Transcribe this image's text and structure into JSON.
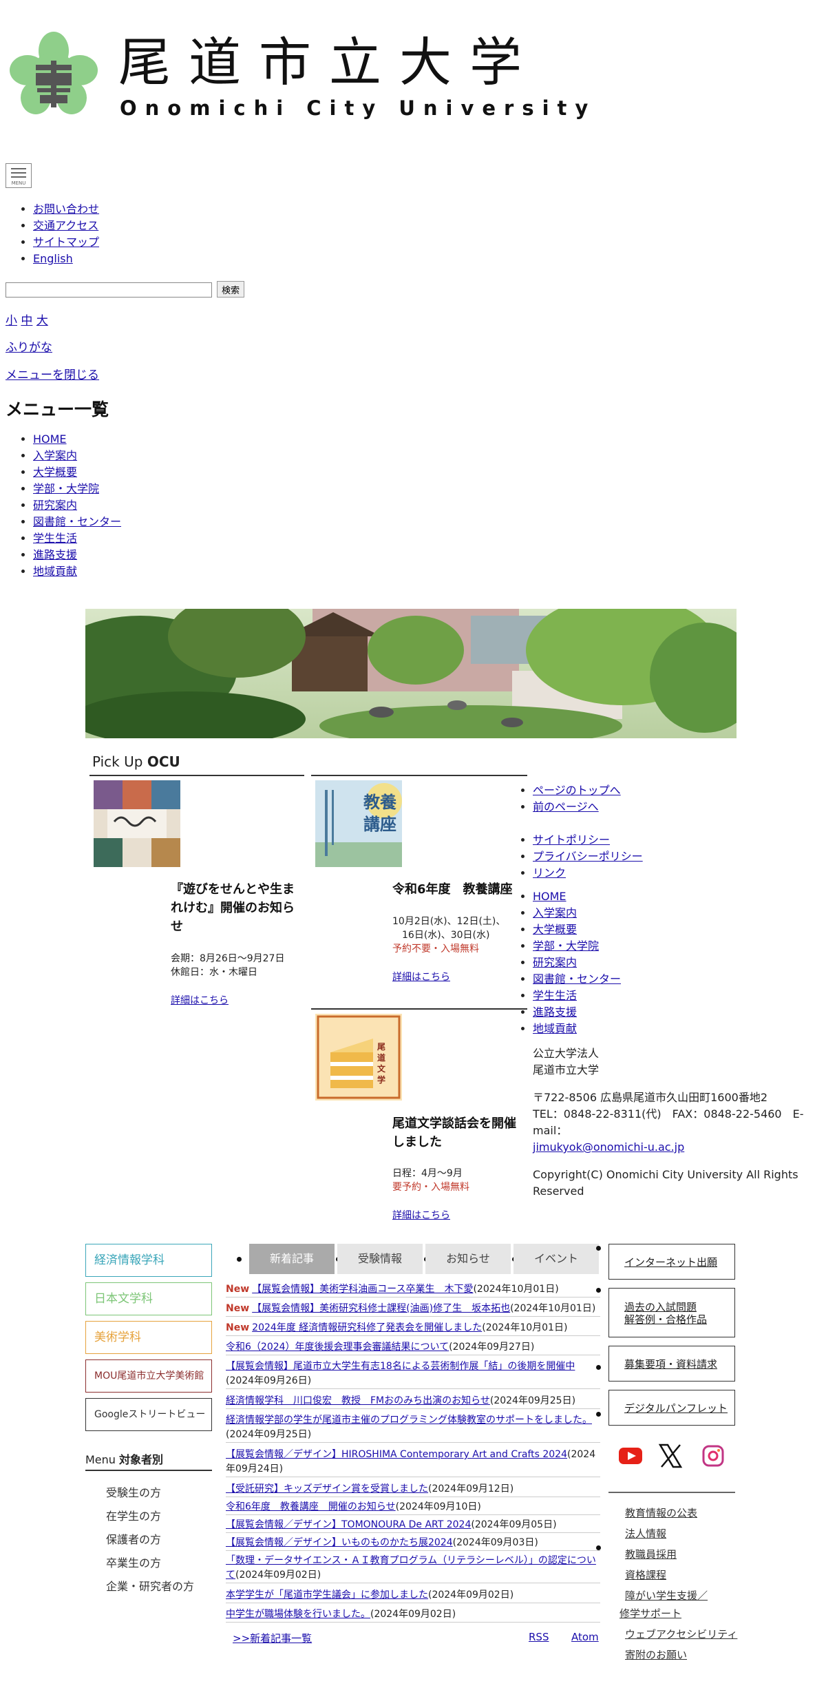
{
  "header": {
    "title_jp": "尾道市立大学",
    "title_en": "Onomichi City University"
  },
  "menu_button": {
    "label": "MENU"
  },
  "top_links": [
    "お問い合わせ",
    "交通アクセス",
    "サイトマップ",
    "English"
  ],
  "search": {
    "placeholder": "",
    "button": "検索"
  },
  "font_size": {
    "small": "小",
    "medium": "中",
    "large": "大"
  },
  "furigana": "ふりがな",
  "close_menu": "メニューを閉じる",
  "menu_heading": "メニュー一覧",
  "menu_items": [
    "HOME",
    "入学案内",
    "大学概要",
    "学部・大学院",
    "研究案内",
    "図書館・センター",
    "学生生活",
    "進路支援",
    "地域貢献"
  ],
  "pickup": {
    "title_prefix": "Pick Up ",
    "title_bold": "OCU",
    "cards": [
      {
        "title": "『遊びをせんとや生まれけむ』開催のお知らせ",
        "line1": "会期：8月26日〜9月27日",
        "line2": "休館日：水・木曜日",
        "red": "",
        "more": "詳細はこちら"
      },
      {
        "title": "令和6年度　教養講座",
        "line1": "10月2日(水)、12日(土)、",
        "line2": "　16日(水)、30日(水)",
        "red": "予約不要・入場無料",
        "more": "詳細はこちら"
      },
      {
        "title": "尾道文学談話会を開催しました",
        "line1": "日程：4月〜9月",
        "line2": "",
        "red": "要予約・入場無料",
        "more": "詳細はこちら"
      }
    ],
    "thumb_texts": {
      "card2": "教養講座",
      "card3": "尾道文学談話会"
    }
  },
  "footer_links1": [
    "ページのトップへ",
    "前のページへ"
  ],
  "footer_links2": [
    "サイトポリシー",
    "プライバシーポリシー",
    "リンク"
  ],
  "footer_menu": [
    "HOME",
    "入学案内",
    "大学概要",
    "学部・大学院",
    "研究案内",
    "図書館・センター",
    "学生生活",
    "進路支援",
    "地域貢献"
  ],
  "footer_info": {
    "org1": "公立大学法人",
    "org2": "尾道市立大学",
    "address": "〒722-8506 広島県尾道市久山田町1600番地2",
    "tel": "TEL：0848-22-8311(代)　FAX：0848-22-5460　E-mail：",
    "email": "jimukyok@onomichi-u.ac.jp",
    "copyright": "Copyright(C) Onomichi City University All Rights Reserved"
  },
  "departments": [
    {
      "label": "経済情報学科",
      "color": "#3aa6b9"
    },
    {
      "label": "日本文学科",
      "color": "#7cc576"
    },
    {
      "label": "美術学科",
      "color": "#e6a23c"
    },
    {
      "label": "MOU尾道市立大学美術館",
      "color": "#8b2d2d"
    },
    {
      "label": "Googleストリートビュー",
      "color": "#333333"
    }
  ],
  "menu_target": {
    "prefix": "Menu ",
    "bold": "対象者別",
    "items": [
      "受験生の方",
      "在学生の方",
      "保護者の方",
      "卒業生の方",
      "企業・研究者の方"
    ]
  },
  "tabs": [
    "新着記事",
    "受験情報",
    "お知らせ",
    "イベント"
  ],
  "news": [
    {
      "new": "New",
      "text": "【展覧会情報】美術学科油画コース卒業生　木下愛",
      "date": "(2024年10月01日)"
    },
    {
      "new": "New",
      "text": "【展覧会情報】美術研究科修士課程(油画)修了生　坂本拓也",
      "date": "(2024年10月01日)"
    },
    {
      "new": "New",
      "text": "2024年度 経済情報研究科修了発表会を開催しました",
      "date": "(2024年10月01日)"
    },
    {
      "new": "",
      "text": "令和6（2024）年度後援会理事会審議結果について",
      "date": "(2024年09月27日)"
    },
    {
      "new": "",
      "text": "【展覧会情報】尾道市立大学生有志18名による芸術制作展「結」の後期を開催中",
      "date": "(2024年09月26日)"
    },
    {
      "new": "",
      "text": "経済情報学科　川口俊宏　教授　FMおのみち出演のお知らせ",
      "date": "(2024年09月25日)"
    },
    {
      "new": "",
      "text": "経済情報学部の学生が尾道市主催のプログラミング体験教室のサポートをしました。",
      "date": "(2024年09月25日)"
    },
    {
      "new": "",
      "text": "【展覧会情報／デザイン】HIROSHIMA Contemporary Art and Crafts 2024",
      "date": "(2024年09月24日)"
    },
    {
      "new": "",
      "text": "【受託研究】キッズデザイン賞を受賞しました",
      "date": "(2024年09月12日)"
    },
    {
      "new": "",
      "text": "令和6年度　教養講座　開催のお知らせ",
      "date": "(2024年09月10日)"
    },
    {
      "new": "",
      "text": "【展覧会情報／デザイン】TOMONOURA De ART 2024",
      "date": "(2024年09月05日)"
    },
    {
      "new": "",
      "text": "【展覧会情報／デザイン】いものものかたち展2024",
      "date": "(2024年09月03日)"
    },
    {
      "new": "",
      "text": "「数理・データサイエンス・ＡＩ教育プログラム（リテラシーレベル）」の認定について",
      "date": "(2024年09月02日)"
    },
    {
      "new": "",
      "text": "本学学生が「尾道市学生議会」に参加しました",
      "date": "(2024年09月02日)"
    },
    {
      "new": "",
      "text": "中学生が職場体験を行いました。",
      "date": "(2024年09月02日)"
    }
  ],
  "news_footer": {
    "all": ">>新着記事一覧",
    "rss": "RSS",
    "atom": "Atom"
  },
  "right_buttons": [
    {
      "line1": "インターネット出願",
      "line2": ""
    },
    {
      "line1": "過去の入試問題",
      "line2": "解答例・合格作品"
    },
    {
      "line1": "募集要項・資料請求",
      "line2": ""
    },
    {
      "line1": "デジタルパンフレット",
      "line2": ""
    }
  ],
  "sns": [
    "youtube-icon",
    "x-icon",
    "instagram-icon"
  ],
  "right_links": [
    "教育情報の公表",
    "法人情報",
    "教職員採用",
    "資格課程",
    "障がい学生支援／",
    "修学サポート",
    "ウェブアクセシビリティ",
    "寄附のお願い"
  ],
  "colors": {
    "accent_red": "#c0392b",
    "link": "#1a0dab"
  }
}
